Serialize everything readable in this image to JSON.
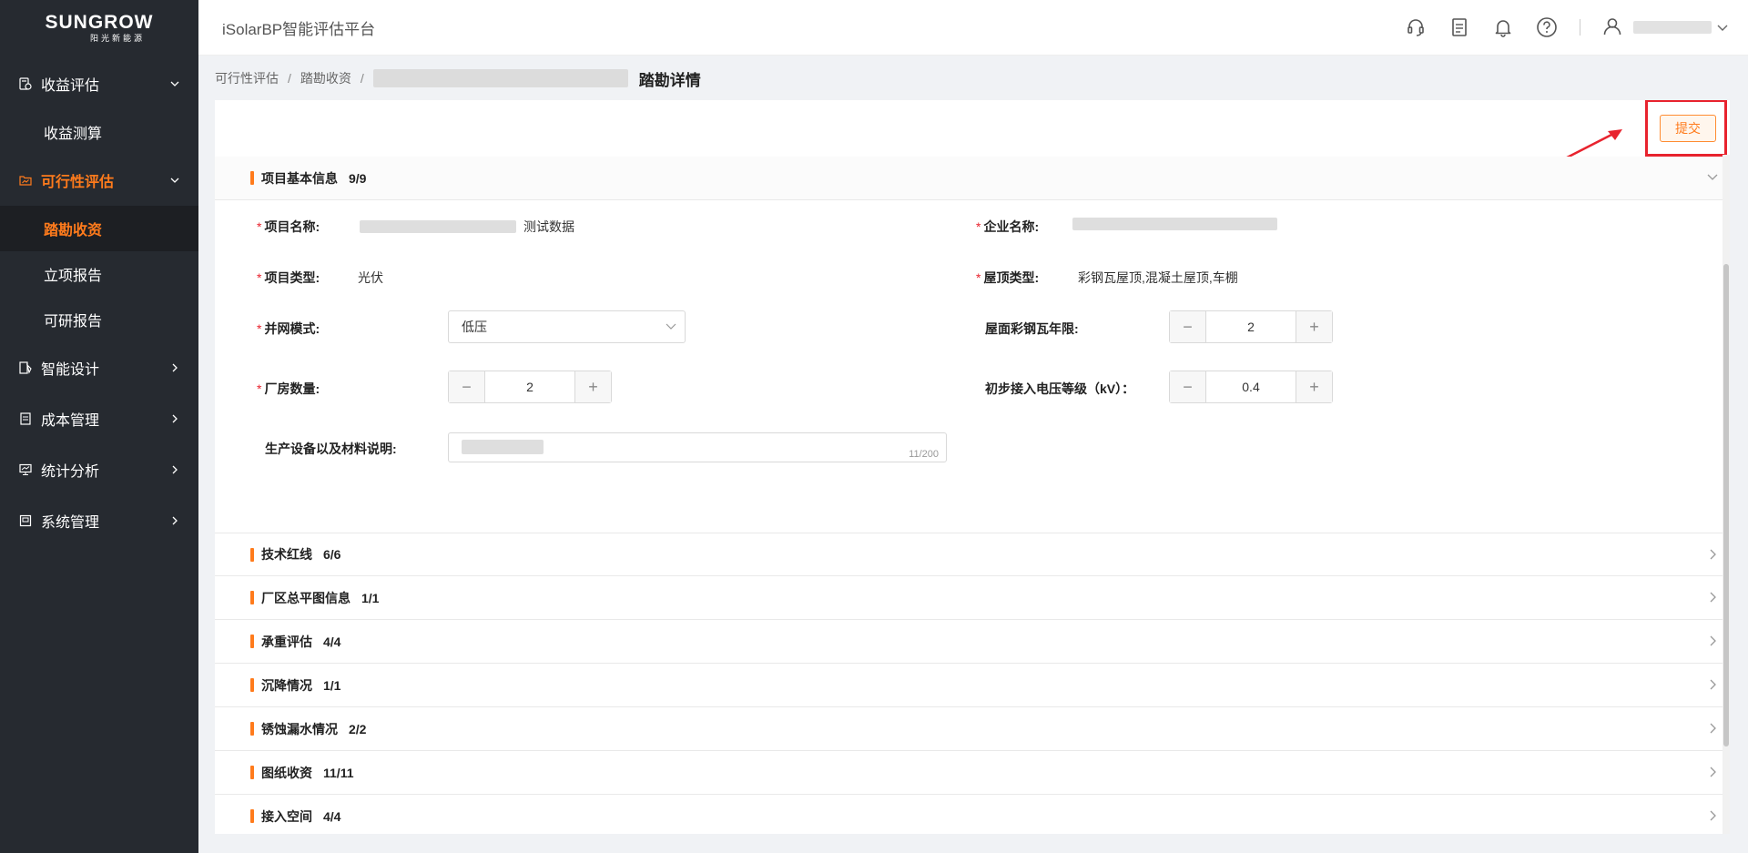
{
  "brand": {
    "logo_main": "SUNGROW",
    "logo_sub": "阳光新能源"
  },
  "header": {
    "app_title": "iSolarBP智能评估平台"
  },
  "sidebar": {
    "groups": [
      {
        "label": "收益评估",
        "expanded": true,
        "icon": "calculator-icon",
        "children": [
          "收益测算"
        ]
      },
      {
        "label": "可行性评估",
        "expanded": true,
        "active": true,
        "icon": "folder-chart-icon",
        "children": [
          "踏勘收资",
          "立项报告",
          "可研报告"
        ],
        "active_child": "踏勘收资"
      },
      {
        "label": "智能设计",
        "expanded": false,
        "icon": "design-icon"
      },
      {
        "label": "成本管理",
        "expanded": false,
        "icon": "ledger-icon"
      },
      {
        "label": "统计分析",
        "expanded": false,
        "icon": "monitor-chart-icon"
      },
      {
        "label": "系统管理",
        "expanded": false,
        "icon": "settings-panel-icon"
      }
    ]
  },
  "breadcrumb": {
    "items": [
      "可行性评估",
      "踏勘收资"
    ],
    "separator": "/",
    "current": "踏勘详情"
  },
  "actions": {
    "submit_label": "提交"
  },
  "sections": [
    {
      "title": "项目基本信息",
      "count": "9/9",
      "expanded": true
    },
    {
      "title": "技术红线",
      "count": "6/6"
    },
    {
      "title": "厂区总平图信息",
      "count": "1/1"
    },
    {
      "title": "承重评估",
      "count": "4/4"
    },
    {
      "title": "沉降情况",
      "count": "1/1"
    },
    {
      "title": "锈蚀漏水情况",
      "count": "2/2"
    },
    {
      "title": "图纸收资",
      "count": "11/11"
    },
    {
      "title": "接入空间",
      "count": "4/4"
    }
  ],
  "form": {
    "project_name": {
      "label": "项目名称:",
      "required": true,
      "value_suffix": "测试数据"
    },
    "company_name": {
      "label": "企业名称:",
      "required": true
    },
    "project_type": {
      "label": "项目类型:",
      "required": true,
      "value": "光伏"
    },
    "roof_type": {
      "label": "屋顶类型:",
      "required": true,
      "value": "彩钢瓦屋顶,混凝土屋顶,车棚"
    },
    "grid_mode": {
      "label": "并网模式:",
      "required": true,
      "value": "低压"
    },
    "roof_steel_years": {
      "label": "屋面彩钢瓦年限:",
      "value": "2"
    },
    "plant_count": {
      "label": "厂房数量:",
      "required": true,
      "value": "2"
    },
    "voltage_level": {
      "label": "初步接入电压等级（kV）：",
      "value": "0.4"
    },
    "equipment_desc": {
      "label": "生产设备以及材料说明:",
      "counter": "11/200"
    }
  },
  "colors": {
    "accent": "#ff7b1c",
    "sidebar_bg": "#262a30",
    "highlight": "#e8232e"
  }
}
